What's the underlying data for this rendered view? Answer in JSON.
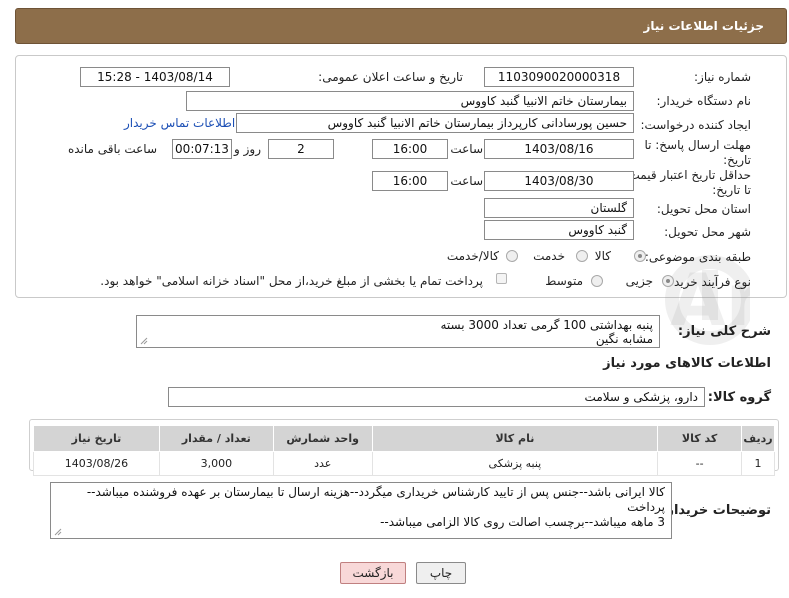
{
  "header": {
    "title": "جزئیات اطلاعات نیاز"
  },
  "fields": {
    "need_number": {
      "label": "شماره نیاز:",
      "value": "1103090020000318"
    },
    "announce_datetime": {
      "label": "تاریخ و ساعت اعلان عمومی:",
      "value": "1403/08/14 - 15:28"
    },
    "buyer_org": {
      "label": "نام دستگاه خریدار:",
      "value": "بیمارستان خاتم الانبیا گنبد کاووس"
    },
    "requester": {
      "label": "ایجاد کننده درخواست:",
      "value": "حسین پورسادانی کارپرداز بیمارستان خاتم الانبیا گنبد کاووس",
      "contact_link": "اطلاعات تماس خریدار"
    },
    "reply_deadline": {
      "label": "مهلت ارسال پاسخ: تا تاریخ:",
      "date": "1403/08/16",
      "time_label": "ساعت",
      "time": "16:00",
      "days": "2",
      "days_label": "روز و",
      "remaining": "00:07:13",
      "remaining_label": "ساعت باقی مانده"
    },
    "price_validity": {
      "label": "حداقل تاریخ اعتبار قیمت: تا تاریخ:",
      "date": "1403/08/30",
      "time_label": "ساعت",
      "time": "16:00"
    },
    "province": {
      "label": "استان محل تحویل:",
      "value": "گلستان"
    },
    "city": {
      "label": "شهر محل تحویل:",
      "value": "گنبد کاووس"
    },
    "category": {
      "label": "طبقه بندی موضوعی:",
      "options": [
        "کالا",
        "خدمت",
        "کالا/خدمت"
      ],
      "selected": "کالا"
    },
    "purchase_type": {
      "label": "نوع فرآیند خرید :",
      "options": [
        "جزیی",
        "متوسط"
      ],
      "selected": "جزیی",
      "checkbox_text": "پرداخت تمام یا بخشی از مبلغ خرید،از محل \"اسناد خزانه اسلامی\" خواهد بود."
    }
  },
  "summary": {
    "label": "شرح کلی نیاز:",
    "text_line1": "پنبه بهداشتی 100 گرمی تعداد 3000 بسته",
    "text_line2": "مشابه نگین"
  },
  "goods_section": {
    "title": "اطلاعات کالاهای مورد نیاز"
  },
  "goods_group": {
    "label": "گروه کالا:",
    "value": "دارو، پزشکی و سلامت"
  },
  "table": {
    "headers": [
      "ردیف",
      "کد کالا",
      "نام کالا",
      "واحد شمارش",
      "تعداد / مقدار",
      "تاریخ نیاز"
    ],
    "rows": [
      {
        "row": "1",
        "code": "--",
        "name": "پنبه پزشکی",
        "unit": "عدد",
        "qty": "3,000",
        "date": "1403/08/26"
      }
    ]
  },
  "buyer_notes": {
    "label": "توضیحات خریدار:",
    "line1": "کالا ایرانی باشد--جنس پس از تایید کارشناس خریداری میگردد--هزینه ارسال تا بیمارستان بر عهده فروشنده میباشد--پرداخت",
    "line2": "3 ماهه  میباشد--برچسب اصالت روی کالا الزامی میباشد--"
  },
  "buttons": {
    "print": "چاپ",
    "back": "بازگشت"
  },
  "watermark": {
    "text": "AriaTender.net"
  }
}
